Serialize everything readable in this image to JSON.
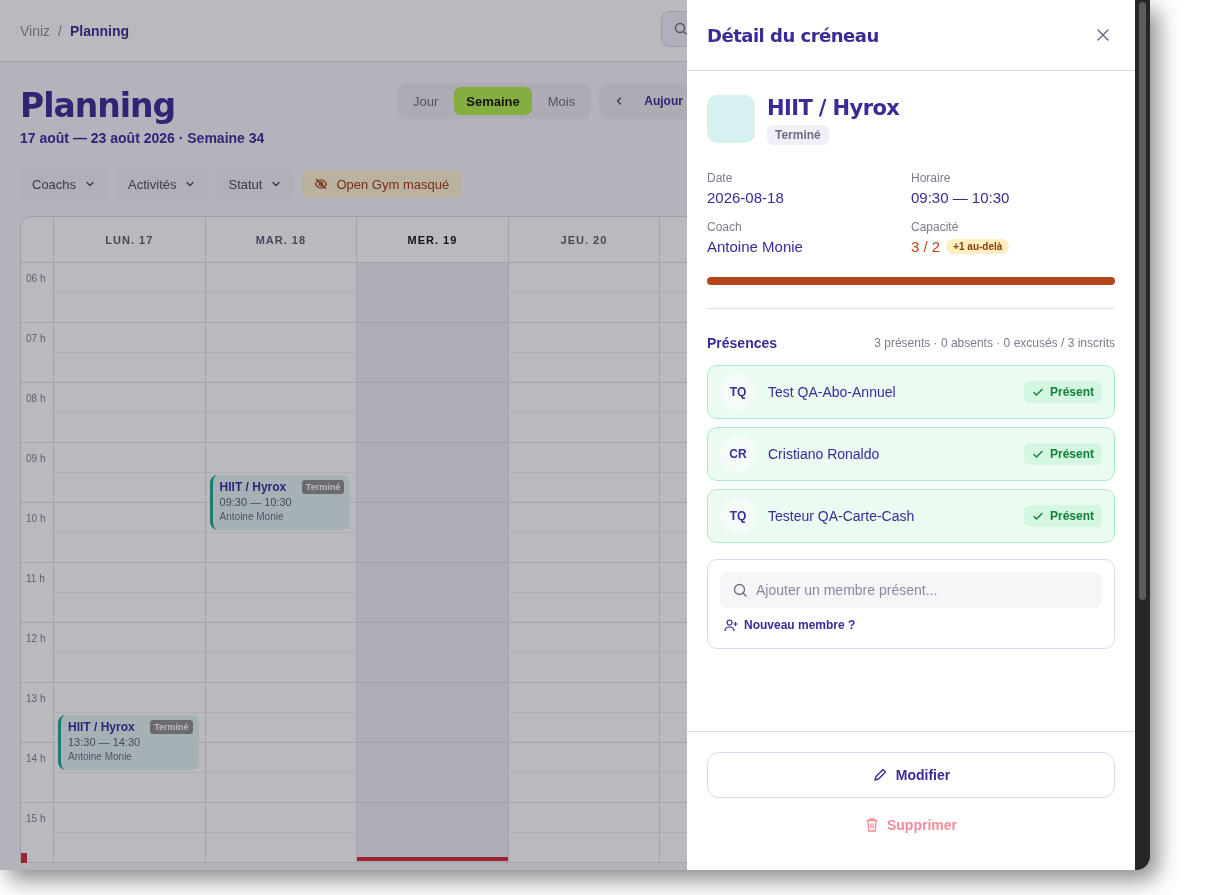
{
  "breadcrumb": [
    {
      "label": "Viniz",
      "current": false
    },
    {
      "label": "Planning",
      "current": true
    }
  ],
  "breadcrumb_separator": "/",
  "page": {
    "title": "Planning",
    "subtitle": "17 août — 23 août 2026 · Semaine 34"
  },
  "view_tabs": [
    {
      "label": "Jour",
      "selected": false
    },
    {
      "label": "Semaine",
      "selected": true
    },
    {
      "label": "Mois",
      "selected": false
    }
  ],
  "nav": {
    "today_label": "Aujour"
  },
  "filters": [
    {
      "label": "Coachs",
      "kind": "dropdown"
    },
    {
      "label": "Activités",
      "kind": "dropdown"
    },
    {
      "label": "Statut",
      "kind": "dropdown"
    },
    {
      "label": "Open Gym masqué",
      "kind": "hidden"
    }
  ],
  "calendar": {
    "hours": [
      "06 h",
      "07 h",
      "08 h",
      "09 h",
      "10 h",
      "11 h",
      "12 h",
      "13 h",
      "14 h",
      "15 h"
    ],
    "days": [
      {
        "label": "LUN. 17",
        "today": false,
        "events": [
          {
            "title": "HIIT / Hyrox",
            "status": "Terminé",
            "time": "13:30 — 14:30",
            "coach": "Antoine Monie"
          }
        ]
      },
      {
        "label": "MAR. 18",
        "today": false,
        "events": [
          {
            "title": "HIIT / Hyrox",
            "status": "Terminé",
            "time": "09:30 — 10:30",
            "coach": "Antoine Monie"
          }
        ]
      },
      {
        "label": "MER. 19",
        "today": true
      },
      {
        "label": "JEU. 20",
        "today": false
      }
    ]
  },
  "drawer": {
    "title": "Détail du créneau",
    "activity": {
      "name": "HIIT / Hyrox",
      "status": "Terminé"
    },
    "details": [
      {
        "label": "Date",
        "value": "2026-08-18",
        "kind": "plain"
      },
      {
        "label": "Horaire",
        "value": "09:30 — 10:30",
        "kind": "plain"
      },
      {
        "label": "Coach",
        "value": "Antoine Monie",
        "kind": "plain"
      },
      {
        "label": "Capacité",
        "value": "3 / 2",
        "kind": "over",
        "badge": "+1 au-delà"
      }
    ],
    "capacity": {
      "level": 1
    },
    "attendance": {
      "title": "Présences",
      "summary": "3 présents · 0 absents · 0 excusés / 3 inscrits",
      "members": [
        {
          "initials": "TQ",
          "name": "Test QA-Abo-Annuel",
          "status": "Présent",
          "present": true
        },
        {
          "initials": "CR",
          "name": "Cristiano Ronaldo",
          "status": "Présent",
          "present": true
        },
        {
          "initials": "TQ",
          "name": "Testeur QA-Carte-Cash",
          "status": "Présent",
          "present": true
        }
      ]
    },
    "add_member": {
      "placeholder": "Ajouter un membre présent...",
      "link": "Nouveau membre ?"
    },
    "actions": {
      "edit": "Modifier",
      "delete": "Supprimer"
    }
  }
}
